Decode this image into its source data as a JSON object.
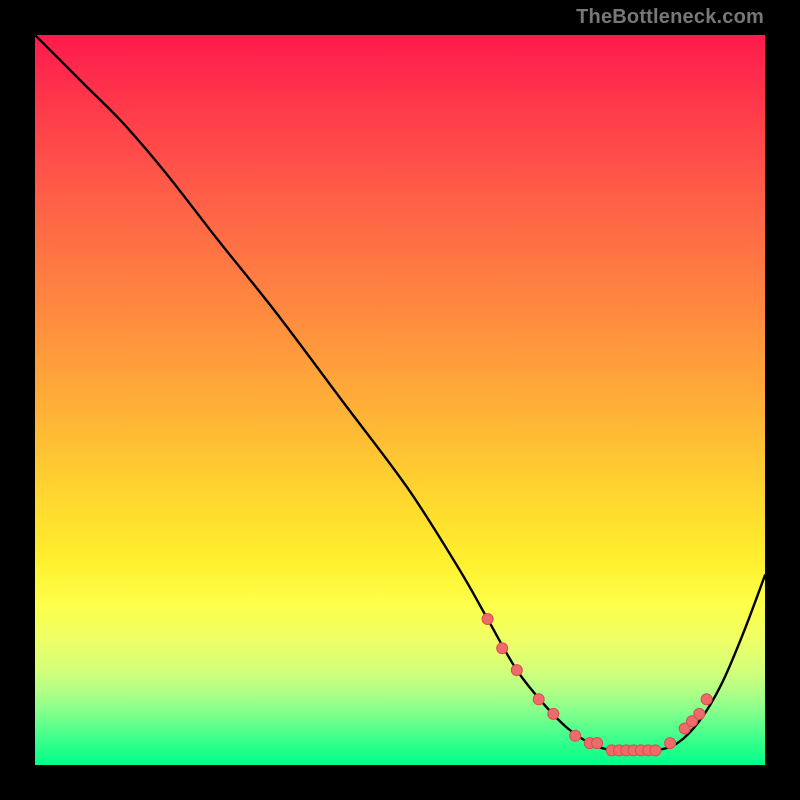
{
  "watermark": "TheBottleneck.com",
  "colors": {
    "curve": "#000000",
    "dot_fill": "#ef6b6b",
    "dot_stroke": "#d94d4d",
    "background_black": "#000000"
  },
  "chart_data": {
    "type": "line",
    "title": "",
    "xlabel": "",
    "ylabel": "",
    "xlim": [
      0,
      100
    ],
    "ylim": [
      0,
      100
    ],
    "grid": false,
    "legend": false,
    "series": [
      {
        "name": "curve",
        "x": [
          0,
          3,
          7,
          12,
          18,
          25,
          33,
          42,
          51,
          58,
          62,
          66,
          70,
          73,
          76,
          79,
          82,
          85,
          88,
          91,
          94,
          97,
          100
        ],
        "y": [
          100,
          97,
          93,
          88,
          81,
          72,
          62,
          50,
          38,
          27,
          20,
          13,
          8,
          5,
          3,
          2,
          2,
          2,
          3,
          6,
          11,
          18,
          26
        ]
      }
    ],
    "dots": [
      {
        "x": 62,
        "y": 20
      },
      {
        "x": 64,
        "y": 16
      },
      {
        "x": 66,
        "y": 13
      },
      {
        "x": 69,
        "y": 9
      },
      {
        "x": 71,
        "y": 7
      },
      {
        "x": 74,
        "y": 4
      },
      {
        "x": 76,
        "y": 3
      },
      {
        "x": 77,
        "y": 3
      },
      {
        "x": 79,
        "y": 2
      },
      {
        "x": 80,
        "y": 2
      },
      {
        "x": 81,
        "y": 2
      },
      {
        "x": 82,
        "y": 2
      },
      {
        "x": 83,
        "y": 2
      },
      {
        "x": 84,
        "y": 2
      },
      {
        "x": 85,
        "y": 2
      },
      {
        "x": 87,
        "y": 3
      },
      {
        "x": 89,
        "y": 5
      },
      {
        "x": 90,
        "y": 6
      },
      {
        "x": 91,
        "y": 7
      },
      {
        "x": 92,
        "y": 9
      }
    ]
  }
}
